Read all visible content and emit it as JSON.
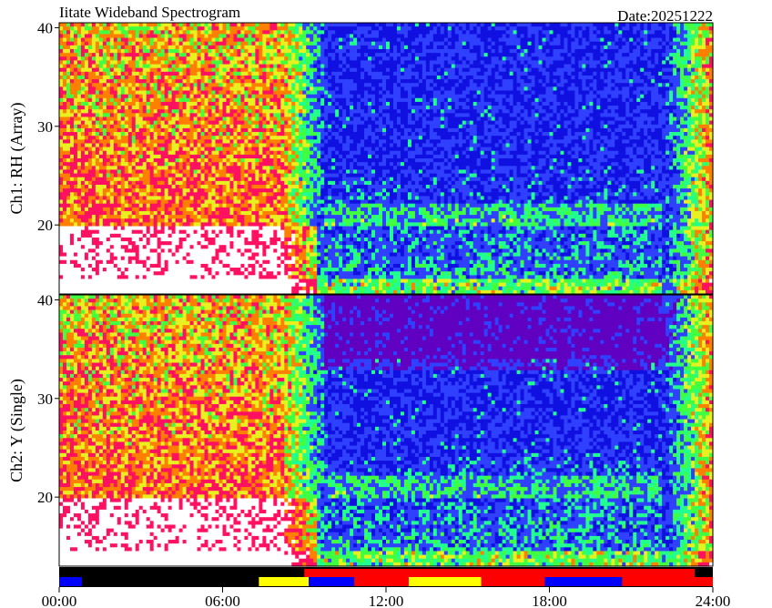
{
  "chart_data": [
    {
      "type": "heatmap",
      "title": "Iitate Wideband Spectrogram",
      "date_label": "Date:20251222",
      "panel": "Ch1: RH (Array)",
      "ylabel": "Ch1: RH (Array)",
      "ylim": [
        13,
        40.5
      ],
      "yticks": [
        20,
        30,
        40
      ],
      "xlabel": "",
      "xlim": [
        "00:00",
        "24:00"
      ],
      "xticks": [
        "00:00",
        "06:00",
        "12:00",
        "18:00",
        "24:00"
      ],
      "colormap": [
        "#ffffff",
        "#ff1060",
        "#ff8000",
        "#e8f020",
        "#40ff40",
        "#20ff90",
        "#3040ff",
        "#1010e0",
        "#6000c0"
      ],
      "description_regions": [
        {
          "time": [
            "00:00",
            "08:30"
          ],
          "level": "high",
          "colors": [
            "#ff1060",
            "#e8f020",
            "#40ff40",
            "#ffffff"
          ]
        },
        {
          "time": [
            "10:00",
            "22:30"
          ],
          "level": "low",
          "colors": [
            "#3040ff",
            "#40ff40"
          ]
        },
        {
          "time": [
            "22:30",
            "24:00"
          ],
          "level": "high",
          "colors": [
            "#40ff40",
            "#ff1060"
          ]
        }
      ]
    },
    {
      "type": "heatmap",
      "panel": "Ch2: Y (Single)",
      "ylabel": "Ch2: Y (Single)",
      "ylim": [
        13,
        40.5
      ],
      "yticks": [
        20,
        30,
        40
      ],
      "xlim": [
        "00:00",
        "24:00"
      ],
      "xticks": [
        "00:00",
        "06:00",
        "12:00",
        "18:00",
        "24:00"
      ],
      "description_regions": [
        {
          "time": [
            "00:00",
            "08:30"
          ],
          "level": "high",
          "colors": [
            "#ff1060",
            "#e8f020",
            "#40ff40",
            "#ffffff"
          ]
        },
        {
          "time": [
            "09:00",
            "22:30"
          ],
          "level": "low",
          "colors": [
            "#6000c0",
            "#3040ff",
            "#40ff40"
          ]
        },
        {
          "time": [
            "22:30",
            "24:00"
          ],
          "level": "high",
          "colors": [
            "#40ff40",
            "#ff1060"
          ]
        }
      ]
    }
  ],
  "status_bar": {
    "background": "#000000",
    "upper_segments": [
      {
        "start": "09:00",
        "end": "23:20",
        "color": "#ff0000"
      }
    ],
    "lower_segments": [
      {
        "start": "00:00",
        "end": "00:50",
        "color": "#0000ff"
      },
      {
        "start": "07:20",
        "end": "09:10",
        "color": "#ffff00"
      },
      {
        "start": "09:10",
        "end": "10:50",
        "color": "#0000ff"
      },
      {
        "start": "10:50",
        "end": "12:50",
        "color": "#ff0000"
      },
      {
        "start": "12:50",
        "end": "15:30",
        "color": "#ffff00"
      },
      {
        "start": "15:30",
        "end": "17:50",
        "color": "#ff0000"
      },
      {
        "start": "17:50",
        "end": "20:40",
        "color": "#0000ff"
      },
      {
        "start": "20:40",
        "end": "24:00",
        "color": "#ff0000"
      }
    ]
  }
}
